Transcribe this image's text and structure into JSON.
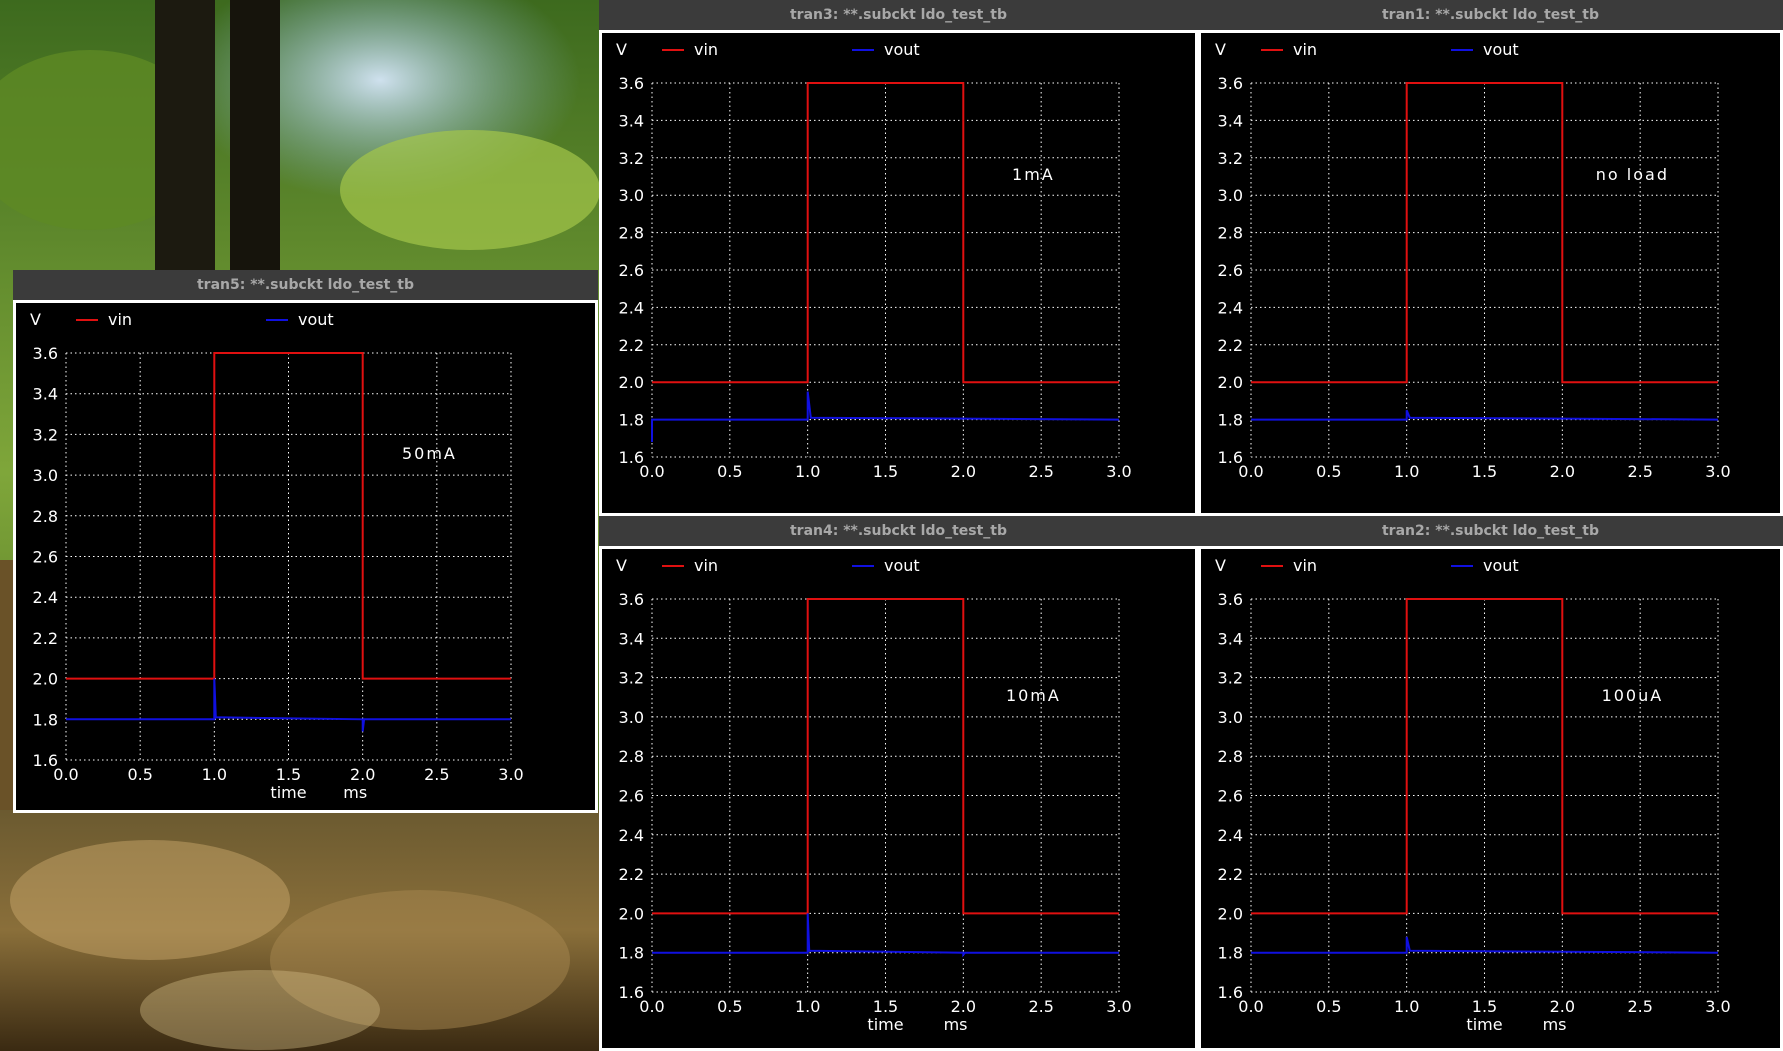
{
  "windows": [
    {
      "id": "tran5",
      "title": "tran5: **.subckt ldo_test_tb",
      "annotation": "50mA",
      "legend": {
        "unit": "V",
        "series": [
          "vin",
          "vout"
        ]
      },
      "xlabel": "time",
      "xunit": "ms",
      "show_xlabel": true
    },
    {
      "id": "tran3",
      "title": "tran3: **.subckt ldo_test_tb",
      "annotation": "1mA",
      "legend": {
        "unit": "V",
        "series": [
          "vin",
          "vout"
        ]
      },
      "xlabel": "time",
      "xunit": "ms",
      "show_xlabel": false
    },
    {
      "id": "tran1",
      "title": "tran1: **.subckt ldo_test_tb",
      "annotation": "no load",
      "legend": {
        "unit": "V",
        "series": [
          "vin",
          "vout"
        ]
      },
      "xlabel": "time",
      "xunit": "ms",
      "show_xlabel": false
    },
    {
      "id": "tran4",
      "title": "tran4: **.subckt ldo_test_tb",
      "annotation": "10mA",
      "legend": {
        "unit": "V",
        "series": [
          "vin",
          "vout"
        ]
      },
      "xlabel": "time",
      "xunit": "ms",
      "show_xlabel": true
    },
    {
      "id": "tran2",
      "title": "tran2: **.subckt ldo_test_tb",
      "annotation": "100uA",
      "legend": {
        "unit": "V",
        "series": [
          "vin",
          "vout"
        ]
      },
      "xlabel": "time",
      "xunit": "ms",
      "show_xlabel": true
    }
  ],
  "colors": {
    "vin": "#e01010",
    "vout": "#1010e0",
    "grid": "#ffffff",
    "text": "#ffffff",
    "background": "#000000"
  },
  "chart_data": [
    {
      "type": "line",
      "window": "tran5",
      "x": [
        0.0,
        1.0,
        1.0,
        2.0,
        2.0,
        3.0
      ],
      "series": [
        {
          "name": "vin",
          "x": [
            0.0,
            1.0,
            1.0,
            2.0,
            2.0,
            3.0
          ],
          "values": [
            2.0,
            2.0,
            3.6,
            3.6,
            2.0,
            2.0
          ]
        },
        {
          "name": "vout",
          "x": [
            0.0,
            1.0,
            1.0,
            1.01,
            2.0,
            2.0,
            2.01,
            3.0
          ],
          "values": [
            1.8,
            1.8,
            2.0,
            1.81,
            1.8,
            1.74,
            1.8,
            1.8
          ]
        }
      ],
      "xlim": [
        0.0,
        3.0
      ],
      "ylim": [
        1.6,
        3.6
      ],
      "xticks": [
        "0.0",
        "0.5",
        "1.0",
        "1.5",
        "2.0",
        "2.5",
        "3.0"
      ],
      "yticks": [
        "1.6",
        "1.8",
        "2.0",
        "2.2",
        "2.4",
        "2.6",
        "2.8",
        "3.0",
        "3.2",
        "3.4",
        "3.6"
      ],
      "grid": true,
      "legend": "top"
    },
    {
      "type": "line",
      "window": "tran3",
      "series": [
        {
          "name": "vin",
          "x": [
            0.0,
            1.0,
            1.0,
            2.0,
            2.0,
            3.0
          ],
          "values": [
            2.0,
            2.0,
            3.6,
            3.6,
            2.0,
            2.0
          ]
        },
        {
          "name": "vout",
          "x": [
            0.0,
            0.0,
            0.01,
            1.0,
            1.0,
            1.02,
            3.0
          ],
          "values": [
            1.68,
            1.8,
            1.8,
            1.8,
            1.95,
            1.81,
            1.8
          ]
        }
      ],
      "xlim": [
        0.0,
        3.0
      ],
      "ylim": [
        1.6,
        3.6
      ],
      "xticks": [
        "0.0",
        "0.5",
        "1.0",
        "1.5",
        "2.0",
        "2.5",
        "3.0"
      ],
      "yticks": [
        "1.6",
        "1.8",
        "2.0",
        "2.2",
        "2.4",
        "2.6",
        "2.8",
        "3.0",
        "3.2",
        "3.4",
        "3.6"
      ],
      "grid": true,
      "legend": "top"
    },
    {
      "type": "line",
      "window": "tran1",
      "series": [
        {
          "name": "vin",
          "x": [
            0.0,
            1.0,
            1.0,
            2.0,
            2.0,
            3.0
          ],
          "values": [
            2.0,
            2.0,
            3.6,
            3.6,
            2.0,
            2.0
          ]
        },
        {
          "name": "vout",
          "x": [
            0.0,
            1.0,
            1.0,
            1.02,
            3.0
          ],
          "values": [
            1.8,
            1.8,
            1.85,
            1.81,
            1.8
          ]
        }
      ],
      "xlim": [
        0.0,
        3.0
      ],
      "ylim": [
        1.6,
        3.6
      ],
      "xticks": [
        "0.0",
        "0.5",
        "1.0",
        "1.5",
        "2.0",
        "2.5",
        "3.0"
      ],
      "yticks": [
        "1.6",
        "1.8",
        "2.0",
        "2.2",
        "2.4",
        "2.6",
        "2.8",
        "3.0",
        "3.2",
        "3.4",
        "3.6"
      ],
      "grid": true,
      "legend": "top"
    },
    {
      "type": "line",
      "window": "tran4",
      "series": [
        {
          "name": "vin",
          "x": [
            0.0,
            1.0,
            1.0,
            2.0,
            2.0,
            3.0
          ],
          "values": [
            2.0,
            2.0,
            3.6,
            3.6,
            2.0,
            2.0
          ]
        },
        {
          "name": "vout",
          "x": [
            0.0,
            1.0,
            1.0,
            1.01,
            2.0,
            2.0,
            2.01,
            3.0
          ],
          "values": [
            1.8,
            1.8,
            2.0,
            1.81,
            1.8,
            1.79,
            1.8,
            1.8
          ]
        }
      ],
      "xlim": [
        0.0,
        3.0
      ],
      "ylim": [
        1.6,
        3.6
      ],
      "xticks": [
        "0.0",
        "0.5",
        "1.0",
        "1.5",
        "2.0",
        "2.5",
        "3.0"
      ],
      "yticks": [
        "1.6",
        "1.8",
        "2.0",
        "2.2",
        "2.4",
        "2.6",
        "2.8",
        "3.0",
        "3.2",
        "3.4",
        "3.6"
      ],
      "grid": true,
      "legend": "top"
    },
    {
      "type": "line",
      "window": "tran2",
      "series": [
        {
          "name": "vin",
          "x": [
            0.0,
            1.0,
            1.0,
            2.0,
            2.0,
            3.0
          ],
          "values": [
            2.0,
            2.0,
            3.6,
            3.6,
            2.0,
            2.0
          ]
        },
        {
          "name": "vout",
          "x": [
            0.0,
            1.0,
            1.0,
            1.02,
            3.0
          ],
          "values": [
            1.8,
            1.8,
            1.88,
            1.81,
            1.8
          ]
        }
      ],
      "xlim": [
        0.0,
        3.0
      ],
      "ylim": [
        1.6,
        3.6
      ],
      "xticks": [
        "0.0",
        "0.5",
        "1.0",
        "1.5",
        "2.0",
        "2.5",
        "3.0"
      ],
      "yticks": [
        "1.6",
        "1.8",
        "2.0",
        "2.2",
        "2.4",
        "2.6",
        "2.8",
        "3.0",
        "3.2",
        "3.4",
        "3.6"
      ],
      "grid": true,
      "legend": "top"
    }
  ]
}
